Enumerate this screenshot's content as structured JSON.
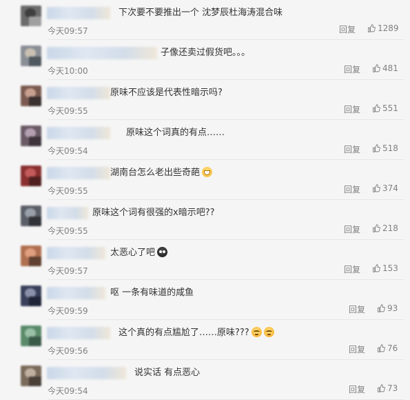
{
  "comments": [
    {
      "text": "下次要不要推出一个 沈梦辰杜海涛混合味",
      "time": "今天09:57",
      "reply": "回复",
      "likes": "1289",
      "emojis": []
    },
    {
      "text": "子像还卖过假货吧。。。",
      "time": "今天10:00",
      "reply": "回复",
      "likes": "481",
      "emojis": []
    },
    {
      "text": "原味不应该是代表性暗示吗?",
      "time": "今天09:55",
      "reply": "回复",
      "likes": "551",
      "emojis": []
    },
    {
      "text": "原味这个词真的有点……",
      "time": "今天09:54",
      "reply": "回复",
      "likes": "518",
      "emojis": []
    },
    {
      "text": "湖南台怎么老出些奇葩",
      "time": "今天09:55",
      "reply": "回复",
      "likes": "374",
      "emojis": [
        "laugh-emoji"
      ]
    },
    {
      "text": "原味这个词有很强的x暗示吧??",
      "time": "今天09:55",
      "reply": "回复",
      "likes": "218",
      "emojis": []
    },
    {
      "text": "太恶心了吧",
      "time": "今天09:57",
      "reply": "回复",
      "likes": "153",
      "emojis": [
        "dark-face-emoji"
      ]
    },
    {
      "text": "呕 一条有味道的咸鱼",
      "time": "今天09:59",
      "reply": "回复",
      "likes": "93",
      "emojis": []
    },
    {
      "text": "这个真的有点尴尬了……原味???",
      "time": "今天09:56",
      "reply": "回复",
      "likes": "76",
      "emojis": [
        "sly-emoji",
        "sly-emoji"
      ]
    },
    {
      "text": "说实话 有点恶心",
      "time": "今天09:54",
      "reply": "回复",
      "likes": "73",
      "emojis": []
    }
  ],
  "icons": {
    "like": "thumbs-up-icon"
  },
  "colors": {
    "background": "#f5f5f5",
    "text": "#333333",
    "meta": "#808080",
    "divider": "#e6e6e6"
  }
}
